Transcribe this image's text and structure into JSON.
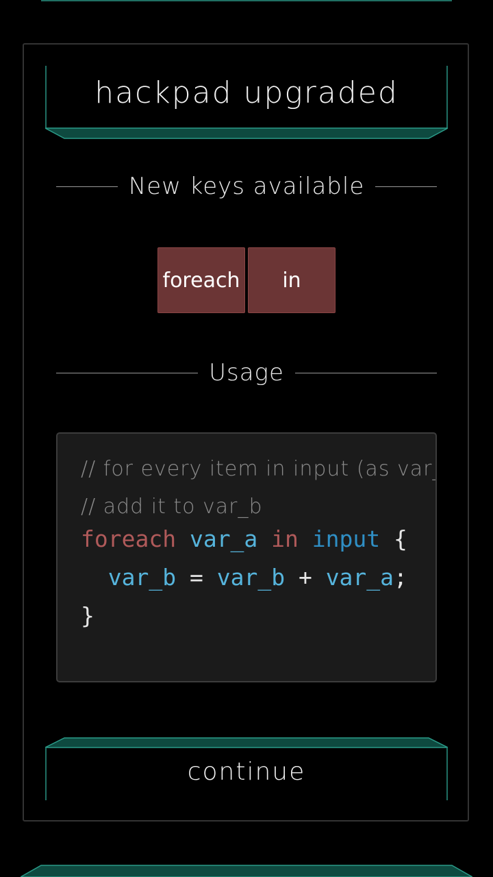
{
  "dialog": {
    "title": "hackpad upgraded",
    "new_keys_header": "New keys available",
    "usage_header": "Usage",
    "continue_label": "continue"
  },
  "keys": [
    {
      "label": "foreach"
    },
    {
      "label": "in"
    }
  ],
  "code": {
    "comment_1": "// for every item in input (as var_a)",
    "comment_2": "// add it to var_b",
    "line1": {
      "kw1": "foreach",
      "v1": "var_a",
      "kw2": "in",
      "v2": "input",
      "brace": "{"
    },
    "line2": {
      "v1": "var_b",
      "op1": "=",
      "v2": "var_b",
      "op2": "+",
      "v3": "var_a",
      "semi": ";"
    },
    "line3": {
      "brace": "}"
    }
  },
  "colors": {
    "accent_teal": "#1f6f63",
    "key_background": "#6b3535",
    "keyword": "#b05a5a",
    "variable": "#56b4dc",
    "builtin": "#2f8fc5"
  }
}
